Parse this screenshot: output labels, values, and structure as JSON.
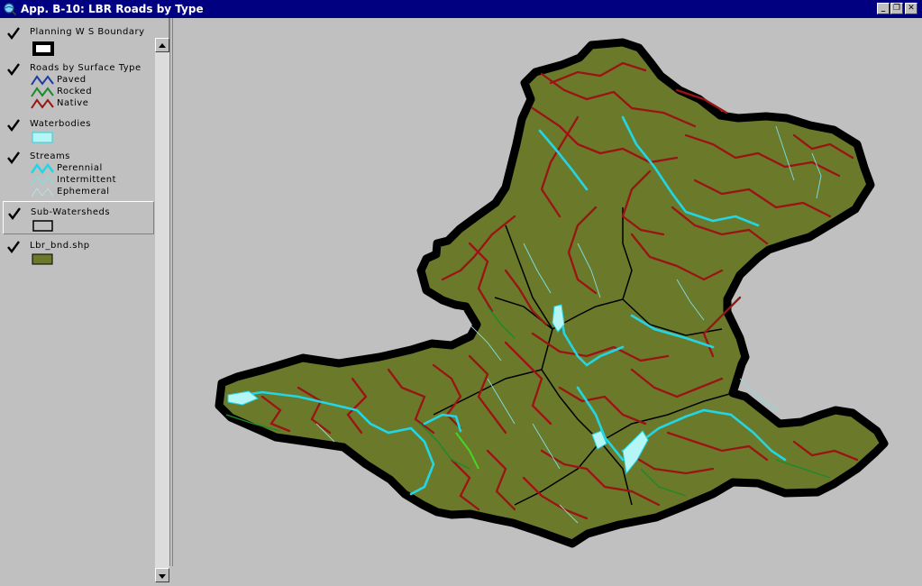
{
  "window": {
    "title": "App. B-10:  LBR Roads by Type",
    "buttons": {
      "minimize": "_",
      "restore": "❐",
      "close": "✕"
    }
  },
  "legend": {
    "layers": [
      {
        "name": "Planning W S Boundary",
        "checked": true
      },
      {
        "name": "Roads by Surface Type",
        "checked": true,
        "classes": [
          {
            "label": "Paved",
            "color": "#1e3ca0"
          },
          {
            "label": "Rocked",
            "color": "#1a8a2a"
          },
          {
            "label": "Native",
            "color": "#9a1414"
          }
        ]
      },
      {
        "name": "Waterbodies",
        "checked": true,
        "fill": "#b4f5f5"
      },
      {
        "name": "Streams",
        "checked": true,
        "classes": [
          {
            "label": "Perennial",
            "color": "#22d6e6"
          },
          {
            "label": "Intermittent",
            "color": "#7fe0e8"
          },
          {
            "label": "Ephemeral",
            "color": "#b0e8ec"
          }
        ]
      },
      {
        "name": "Sub-Watersheds",
        "checked": true,
        "selected": true
      },
      {
        "name": "Lbr_bnd.shp",
        "checked": true,
        "fill": "#6b7a2a"
      }
    ]
  },
  "map_colors": {
    "background": "#c0c0c0",
    "boundary": "#000000",
    "land": "#6b7a2a",
    "roads_native": "#9a1414",
    "roads_rocked": "#1a8a2a",
    "streams": "#22d6e6"
  }
}
